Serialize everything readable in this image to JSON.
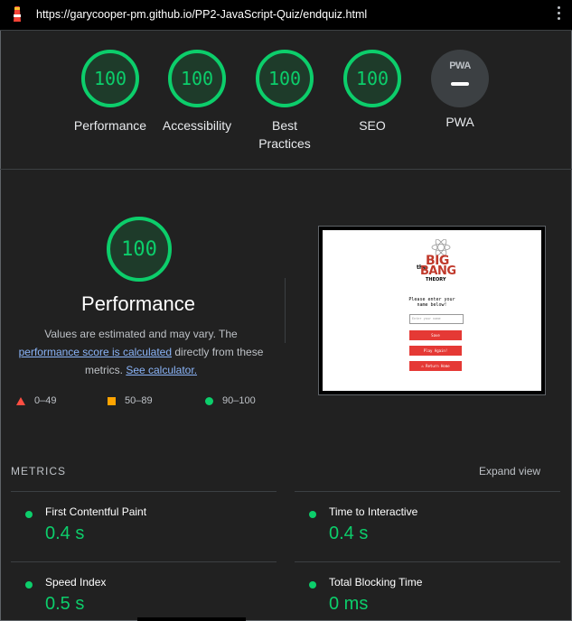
{
  "url_bar": {
    "url": "https://garycooper-pm.github.io/PP2-JavaScript-Quiz/endquiz.html"
  },
  "summary": {
    "gauges": [
      {
        "score": "100",
        "label": "Performance"
      },
      {
        "score": "100",
        "label": "Accessibility"
      },
      {
        "score": "100",
        "label": "Best Practices"
      },
      {
        "score": "100",
        "label": "SEO"
      }
    ],
    "pwa": {
      "badge_text": "PWA",
      "label": "PWA"
    }
  },
  "performance": {
    "score": "100",
    "title": "Performance",
    "desc_part1": "Values are estimated and may vary. The",
    "desc_link1": "performance score is calculated",
    "desc_part2": " directly from these metrics. ",
    "desc_link2": "See calculator."
  },
  "legend": {
    "fail": "0–49",
    "average": "50–89",
    "pass": "90–100"
  },
  "thumbnail": {
    "logo_the": "the",
    "logo_big": "BIG",
    "logo_bang": "BANG",
    "logo_theory": "THEORY",
    "prompt": "Please enter your name below!",
    "input_placeholder": "Enter your name",
    "save": "Save",
    "play_again": "Play Again!",
    "return_home": "Return Home"
  },
  "metrics": {
    "header": "METRICS",
    "expand": "Expand view",
    "items": [
      {
        "name": "First Contentful Paint",
        "value": "0.4 s"
      },
      {
        "name": "Time to Interactive",
        "value": "0.4 s"
      },
      {
        "name": "Speed Index",
        "value": "0.5 s"
      },
      {
        "name": "Total Blocking Time",
        "value": "0 ms"
      }
    ]
  },
  "colors": {
    "pass": "#0cce6b",
    "average": "#ffa400",
    "fail": "#ff4e42",
    "link": "#8ab4f8"
  }
}
